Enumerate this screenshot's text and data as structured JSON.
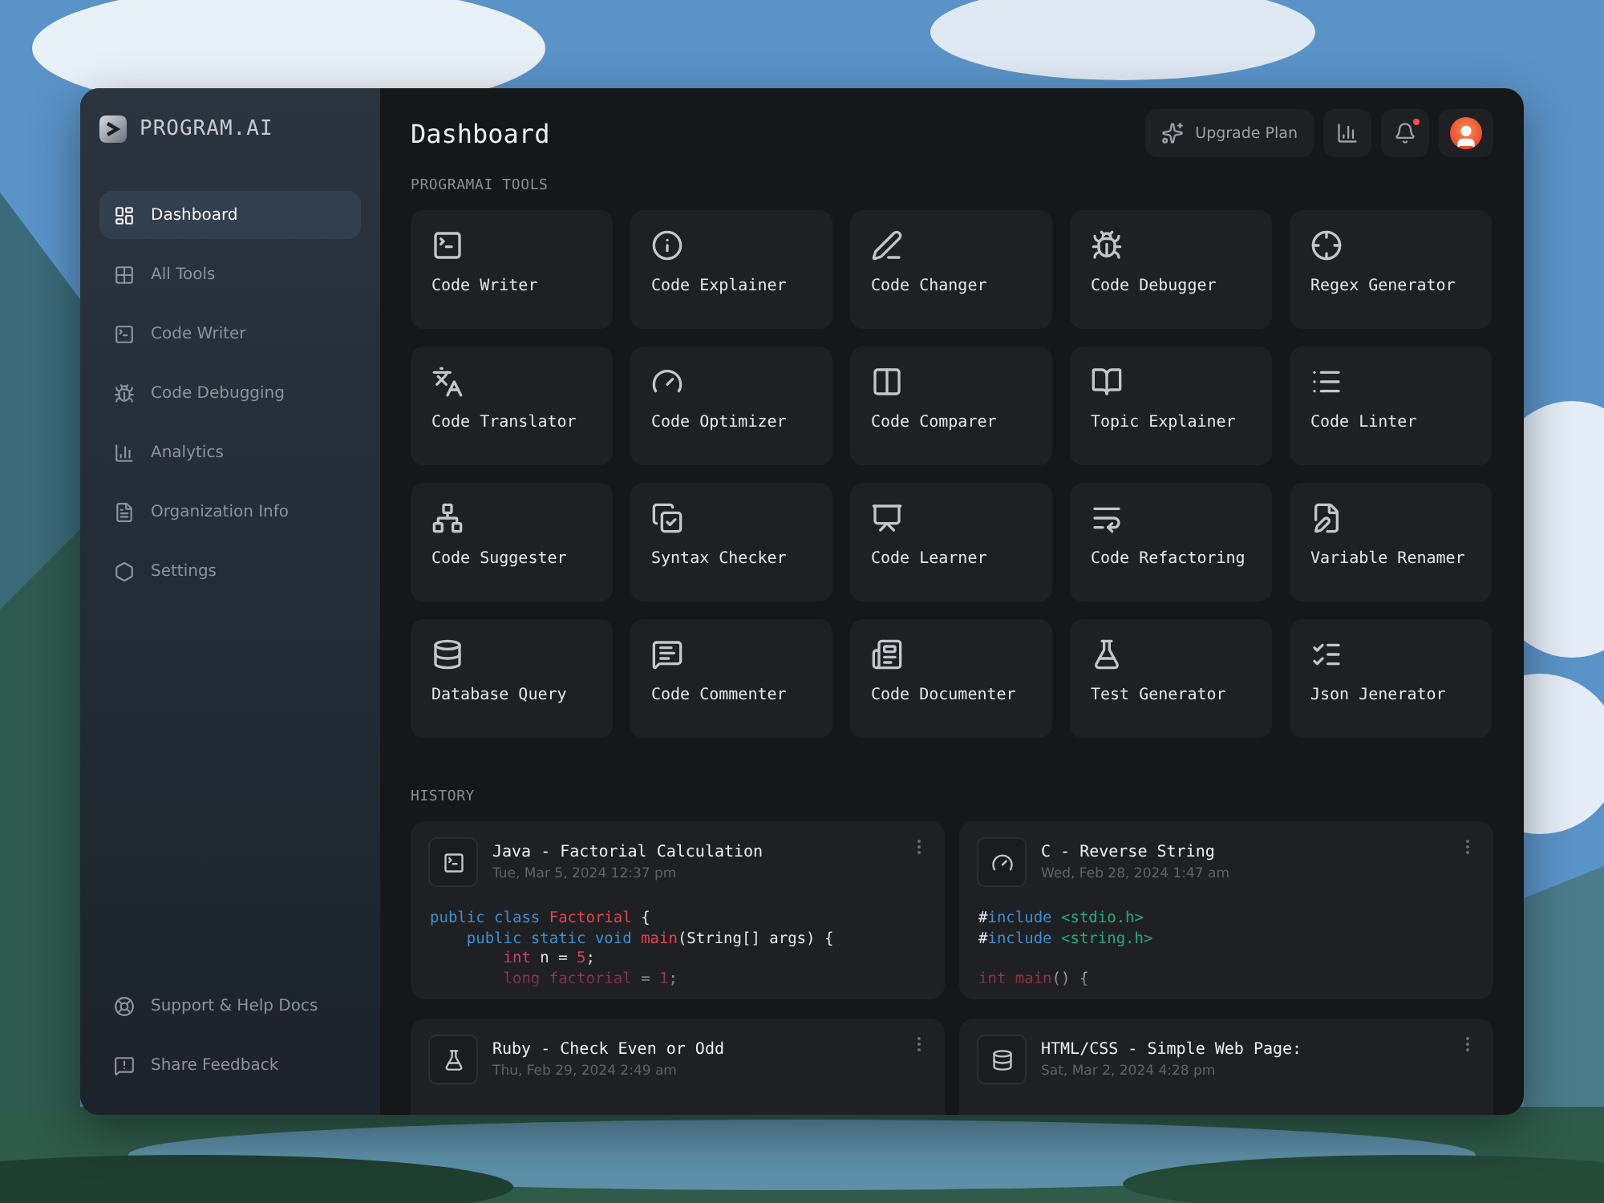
{
  "brand": {
    "name": "PROGRAM.AI"
  },
  "sidebar": {
    "items": [
      {
        "label": "Dashboard",
        "selected": true
      },
      {
        "label": "All Tools",
        "selected": false
      },
      {
        "label": "Code Writer",
        "selected": false
      },
      {
        "label": "Code Debugging",
        "selected": false
      },
      {
        "label": "Analytics",
        "selected": false
      },
      {
        "label": "Organization Info",
        "selected": false
      },
      {
        "label": "Settings",
        "selected": false
      }
    ],
    "footer_items": [
      {
        "label": "Support & Help Docs"
      },
      {
        "label": "Share Feedback"
      }
    ]
  },
  "header": {
    "title": "Dashboard",
    "upgrade_button": "Upgrade Plan",
    "notification_unread": true
  },
  "tools": {
    "heading": "PROGRAMAI TOOLS",
    "items": [
      "Code Writer",
      "Code Explainer",
      "Code Changer",
      "Code Debugger",
      "Regex Generator",
      "Code Translator",
      "Code Optimizer",
      "Code Comparer",
      "Topic Explainer",
      "Code Linter",
      "Code Suggester",
      "Syntax Checker",
      "Code Learner",
      "Code Refactoring",
      "Variable Renamer",
      "Database Query",
      "Code Commenter",
      "Code Documenter",
      "Test Generator",
      "Json Jenerator"
    ]
  },
  "history": {
    "heading": "HISTORY",
    "items": [
      {
        "title": "Java - Factorial Calculation",
        "date": "Tue, Mar 5, 2024 12:37 pm",
        "code": [
          {
            "tokens": [
              {
                "kind": "keyword",
                "text": "public class "
              },
              {
                "kind": "name",
                "text": "Factorial"
              },
              {
                "kind": "plain",
                "text": " {"
              }
            ]
          },
          {
            "tokens": [
              {
                "kind": "keyword",
                "text": "    public static void "
              },
              {
                "kind": "name",
                "text": "main"
              },
              {
                "kind": "plain",
                "text": "(String[] args) {"
              }
            ]
          },
          {
            "tokens": [
              {
                "kind": "type",
                "text": "        int"
              },
              {
                "kind": "plain",
                "text": " n = "
              },
              {
                "kind": "number",
                "text": "5"
              },
              {
                "kind": "plain",
                "text": ";"
              }
            ]
          },
          {
            "tokens": [
              {
                "kind": "type",
                "text": "        long factorial"
              },
              {
                "kind": "plain",
                "text": " = "
              },
              {
                "kind": "number",
                "text": "1"
              },
              {
                "kind": "plain",
                "text": ";"
              }
            ]
          }
        ]
      },
      {
        "title": "C - Reverse String",
        "date": "Wed, Feb 28, 2024 1:47 am",
        "code": [
          {
            "tokens": [
              {
                "kind": "plain",
                "text": "#"
              },
              {
                "kind": "keyword",
                "text": "include"
              },
              {
                "kind": "string",
                "text": " <stdio.h>"
              }
            ]
          },
          {
            "tokens": [
              {
                "kind": "plain",
                "text": "#"
              },
              {
                "kind": "keyword",
                "text": "include"
              },
              {
                "kind": "string",
                "text": " <string.h>"
              }
            ]
          },
          {
            "kind": "blank"
          },
          {
            "tokens": [
              {
                "kind": "type",
                "text": "int"
              },
              {
                "kind": "name",
                "text": " main"
              },
              {
                "kind": "plain",
                "text": "() {"
              }
            ]
          }
        ]
      },
      {
        "title": "Ruby - Check Even or Odd",
        "date": "Thu, Feb 29, 2024 2:49 am"
      },
      {
        "title": "HTML/CSS - Simple Web Page:",
        "date": "Sat, Mar 2, 2024 4:28 pm"
      }
    ]
  }
}
